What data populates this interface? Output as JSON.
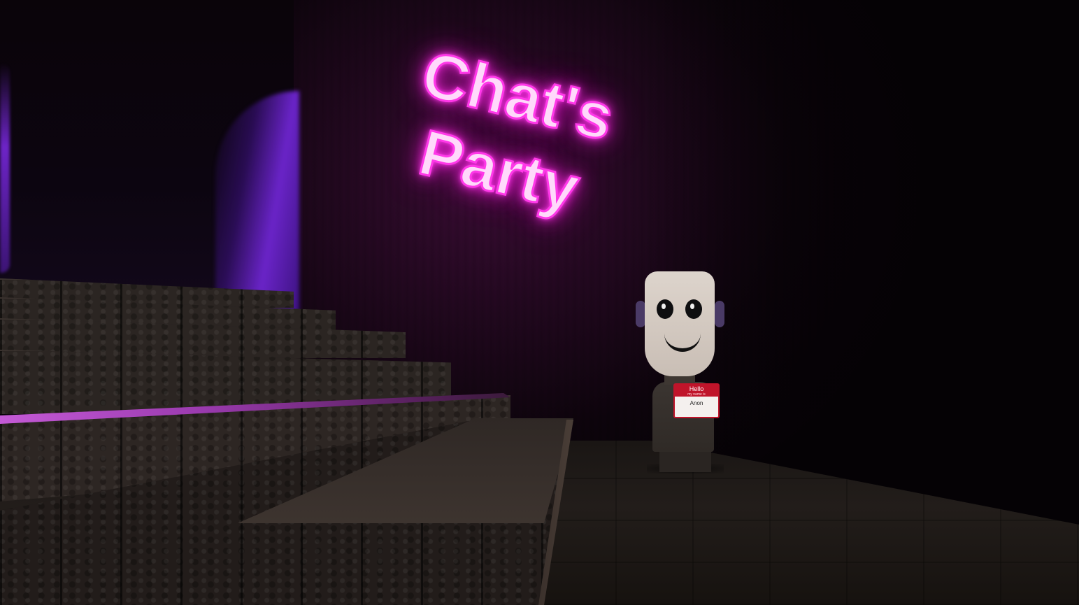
{
  "scene": {
    "neon_sign": {
      "line1": "Chat's",
      "line2": "Party",
      "color": "#ff38e8"
    },
    "character": {
      "name_tag": {
        "header": "Hello",
        "subheader": "my name is",
        "name": "Anon"
      },
      "headphones_color": "#4a3a66"
    },
    "lighting": {
      "accent_purple": "#6a24c8",
      "stage_strip": "#c45ad6"
    }
  }
}
